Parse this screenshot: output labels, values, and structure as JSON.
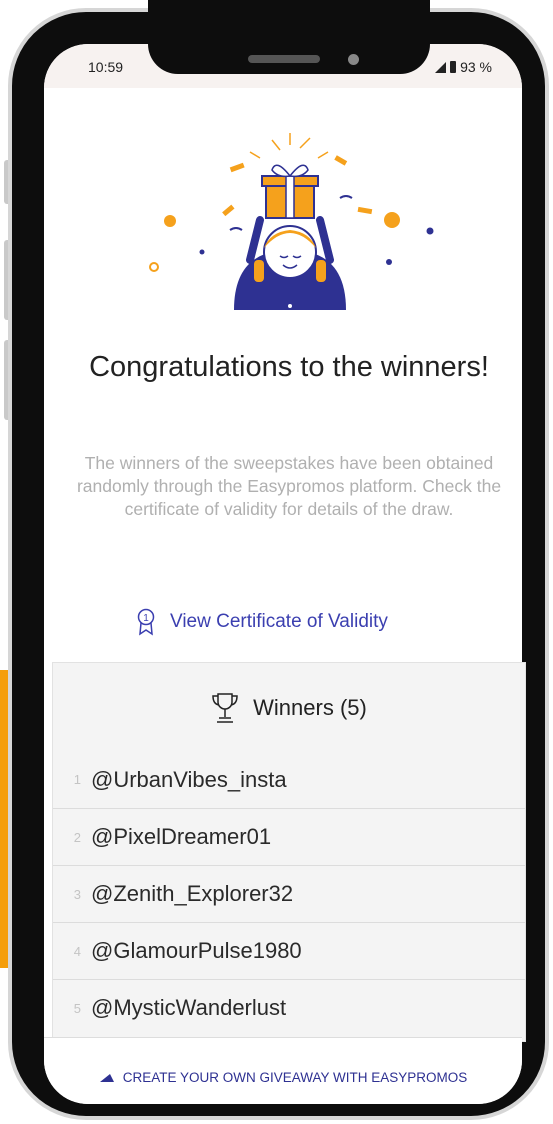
{
  "status_bar": {
    "time": "10:59",
    "battery": "93 %"
  },
  "heading": "Congratulations to the winners!",
  "description": "The winners of the sweepstakes have been obtained randomly through the Easypromos platform. Check the certificate of validity for details of the draw.",
  "certificate_link": "View Certificate of Validity",
  "winners": {
    "title": "Winners (5)",
    "list": [
      {
        "rank": "1",
        "handle": "@UrbanVibes_insta"
      },
      {
        "rank": "2",
        "handle": "@PixelDreamer01"
      },
      {
        "rank": "3",
        "handle": "@Zenith_Explorer32"
      },
      {
        "rank": "4",
        "handle": "@GlamourPulse1980"
      },
      {
        "rank": "5",
        "handle": "@MysticWanderlust"
      }
    ]
  },
  "footer": {
    "cta": "CREATE YOUR OWN GIVEAWAY WITH EASYPROMOS"
  },
  "colors": {
    "accent_blue": "#2e3192",
    "link_blue": "#3b3fb0",
    "orange": "#f5a11c"
  },
  "icons": {
    "certificate": "ribbon-medal-icon",
    "trophy": "trophy-icon",
    "footer": "easypromos-logo-icon"
  }
}
